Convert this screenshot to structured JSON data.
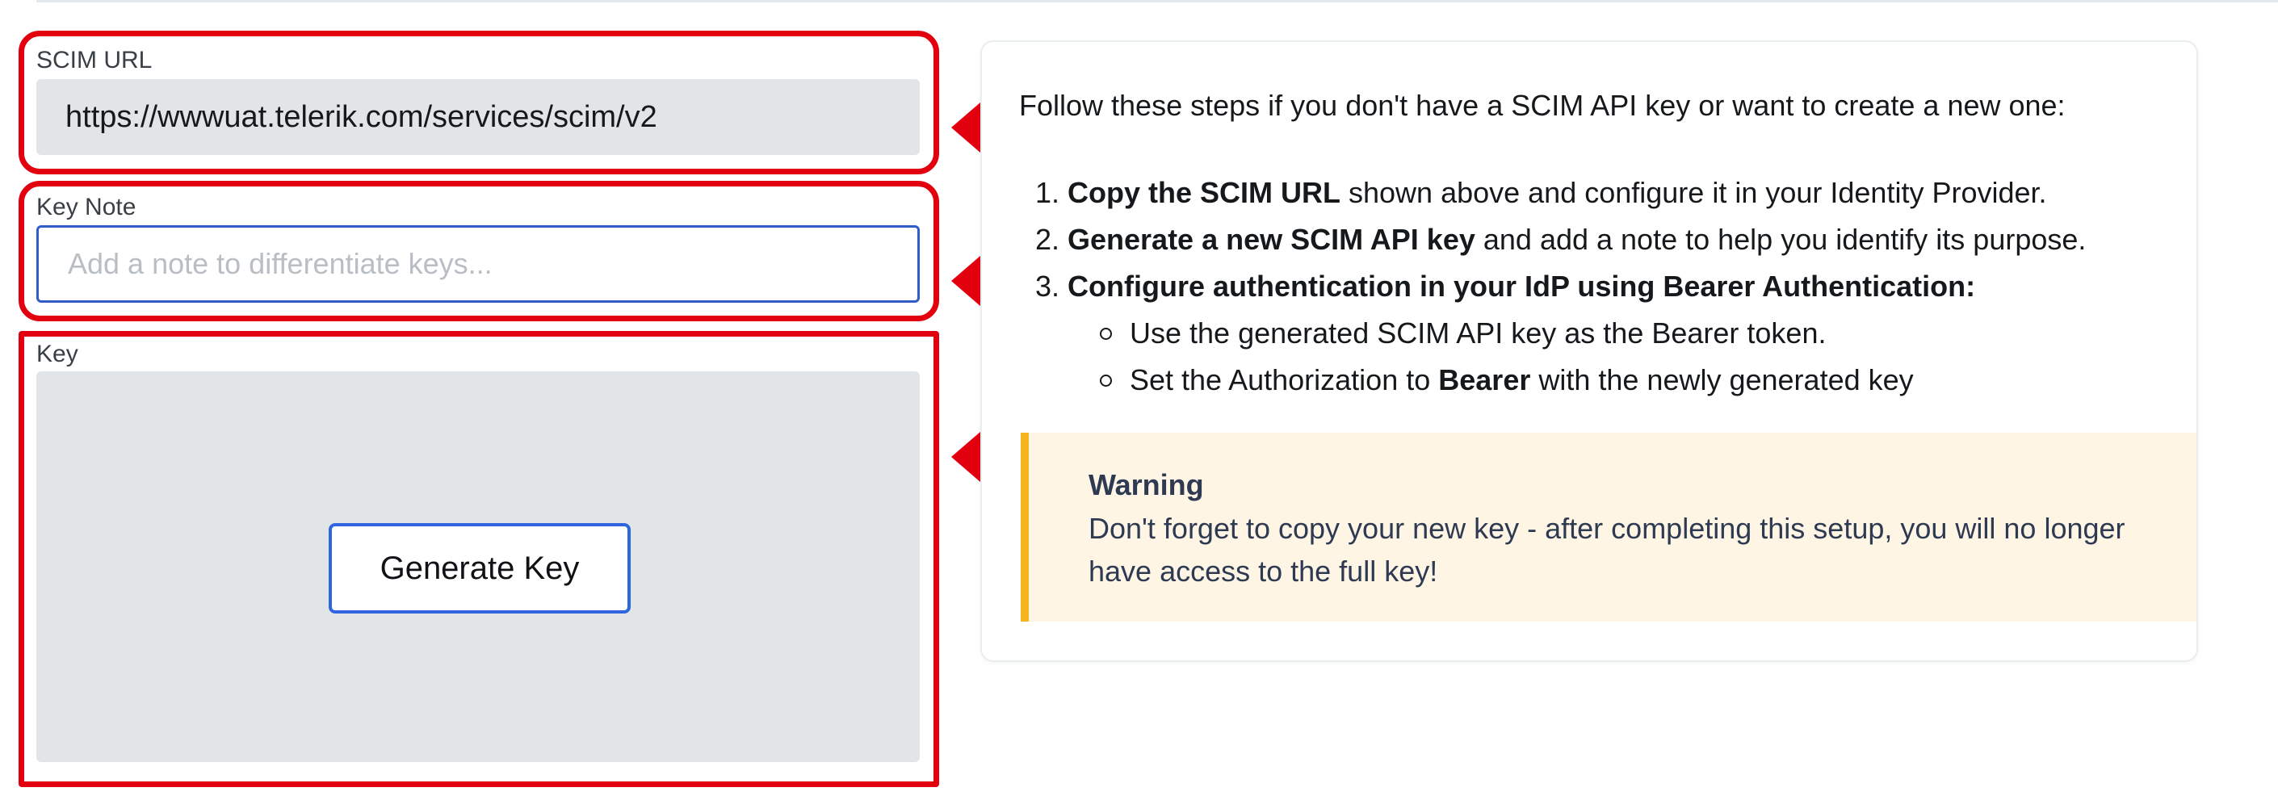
{
  "scim_url": {
    "label": "SCIM URL",
    "value": "https://wwwuat.telerik.com/services/scim/v2"
  },
  "key_note": {
    "label": "Key Note",
    "value": "",
    "placeholder": "Add a note to differentiate keys..."
  },
  "key": {
    "label": "Key",
    "generate_button": "Generate Key"
  },
  "instructions": {
    "intro": "Follow these steps if you don't have a SCIM API key or want to create a new one:",
    "steps": [
      {
        "num": "1.",
        "bold": "Copy the SCIM URL",
        "rest": " shown above and configure it in your Identity Provider."
      },
      {
        "num": "2.",
        "bold": "Generate a new SCIM API key",
        "rest": " and add a note to help you identify its purpose."
      },
      {
        "num": "3.",
        "bold": "Configure authentication in your IdP using Bearer Authentication:",
        "rest": ""
      }
    ],
    "substeps": [
      {
        "text": "Use the generated SCIM API key as the Bearer token.",
        "pre": "",
        "bold": "",
        "post": ""
      },
      {
        "text": "",
        "pre": "Set the Authorization to ",
        "bold": "Bearer",
        "post": " with the newly generated key"
      }
    ]
  },
  "warning": {
    "title": "Warning",
    "text": "Don't forget to copy your new key - after completing this setup, you will no longer have access to the full key!"
  },
  "colors": {
    "highlight": "#e2000f",
    "accent_blue": "#2f66e0",
    "warning_bar": "#f5b51e",
    "warning_bg": "#fff5e5",
    "field_bg": "#e2e5e8"
  },
  "icons": {
    "annotation_arrow": "left-arrow-icon",
    "list_bullet": "hollow-circle-bullet-icon"
  }
}
